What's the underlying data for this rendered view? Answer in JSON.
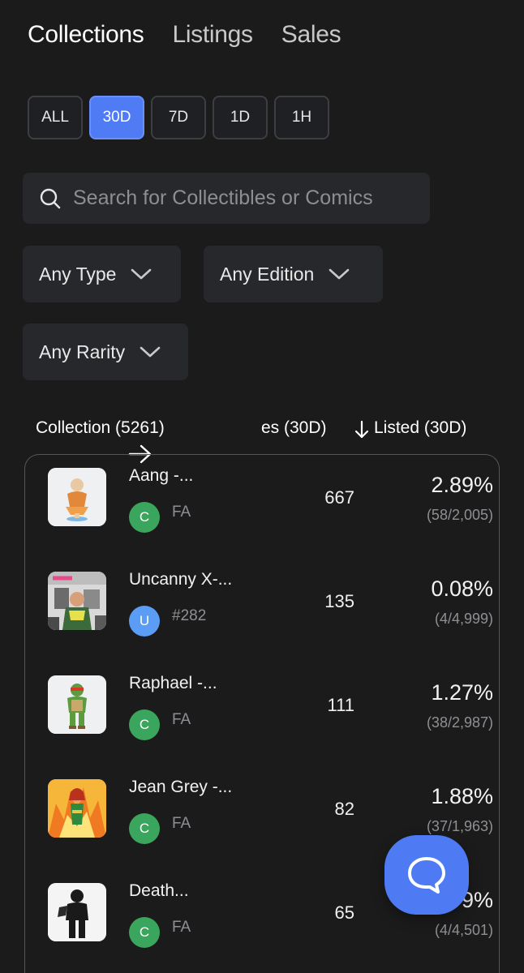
{
  "tabs": [
    {
      "label": "Collections",
      "active": true
    },
    {
      "label": "Listings",
      "active": false
    },
    {
      "label": "Sales",
      "active": false
    }
  ],
  "periods": [
    {
      "label": "ALL",
      "active": false
    },
    {
      "label": "30D",
      "active": true
    },
    {
      "label": "7D",
      "active": false
    },
    {
      "label": "1D",
      "active": false
    },
    {
      "label": "1H",
      "active": false
    }
  ],
  "search": {
    "placeholder": "Search for Collectibles or Comics",
    "value": ""
  },
  "filters": {
    "type": "Any Type",
    "edition": "Any Edition",
    "rarity": "Any Rarity"
  },
  "table": {
    "col_collection": "Collection (5261)",
    "col_sales": "es (30D)",
    "col_listed": "Listed (30D)",
    "rows": [
      {
        "name": "Aang -...",
        "badge": "C",
        "badge_color": "#3aa55c",
        "edition": "FA",
        "sales": "667",
        "percent": "2.89%",
        "ratio": "(58/2,005)",
        "thumb": "aang"
      },
      {
        "name": "Uncanny X-...",
        "badge": "U",
        "badge_color": "#5b9cf5",
        "edition": "#282",
        "sales": "135",
        "percent": "0.08%",
        "ratio": "(4/4,999)",
        "thumb": "comic"
      },
      {
        "name": "Raphael -...",
        "badge": "C",
        "badge_color": "#3aa55c",
        "edition": "FA",
        "sales": "111",
        "percent": "1.27%",
        "ratio": "(38/2,987)",
        "thumb": "raphael"
      },
      {
        "name": "Jean Grey -...",
        "badge": "C",
        "badge_color": "#3aa55c",
        "edition": "FA",
        "sales": "82",
        "percent": "1.88%",
        "ratio": "(37/1,963)",
        "thumb": "jean"
      },
      {
        "name": "Death...",
        "badge": "C",
        "badge_color": "#3aa55c",
        "edition": "FA",
        "sales": "65",
        "percent": "9%",
        "ratio": "(4/4,501)",
        "thumb": "death"
      }
    ]
  },
  "icons": {
    "search": "search-icon",
    "chevron": "chevron-down-icon",
    "sort": "arrow-down-icon",
    "scroll": "arrow-right-icon",
    "chat": "chat-bubble-icon"
  },
  "colors": {
    "background": "#1c1b1c",
    "accent": "#4f7bf5",
    "common_badge": "#3aa55c",
    "uncommon_badge": "#5b9cf5"
  }
}
